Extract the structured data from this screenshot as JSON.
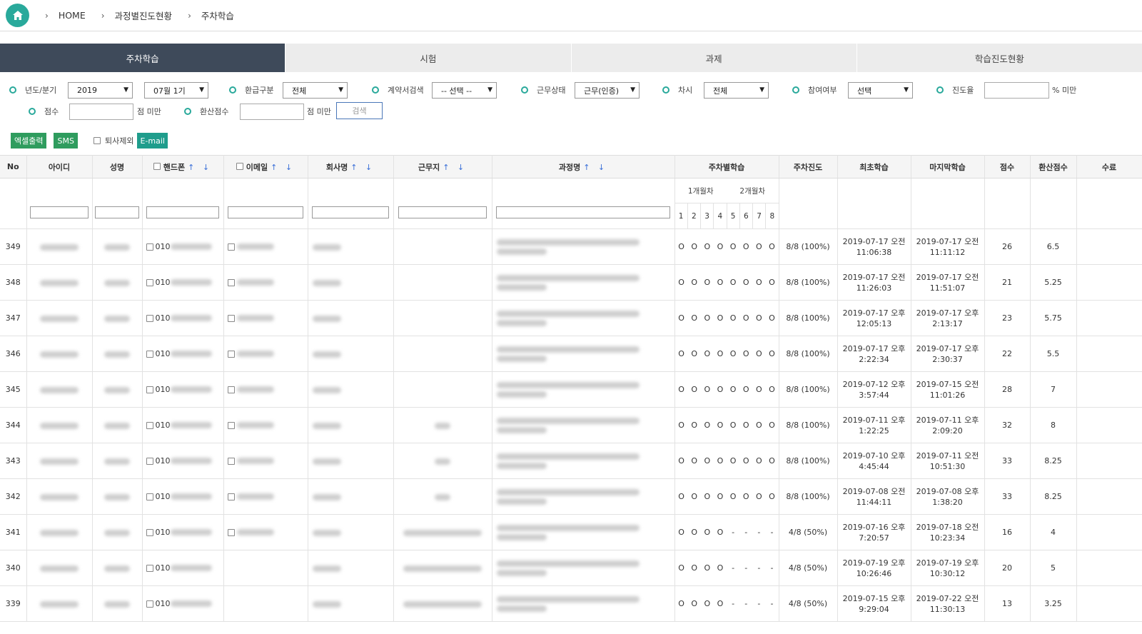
{
  "breadcrumb": {
    "items": [
      "HOME",
      "과정별진도현황",
      "주차학습"
    ]
  },
  "tabs": [
    {
      "label": "주차학습",
      "active": true
    },
    {
      "label": "시험",
      "active": false
    },
    {
      "label": "과제",
      "active": false
    },
    {
      "label": "학습진도현황",
      "active": false
    }
  ],
  "filters": {
    "year_label": "년도/분기",
    "year_value": "2019",
    "quarter_value": "07월 1기",
    "refund_label": "환급구분",
    "refund_value": "전체",
    "contract_label": "계약서검색",
    "contract_value": "-- 선택 --",
    "work_label": "근무상태",
    "work_value": "근무(인증)",
    "round_label": "차시",
    "round_value": "전체",
    "participate_label": "참여여부",
    "participate_value": "선택",
    "progress_label": "진도율",
    "progress_unit": "% 미만",
    "score_label": "점수",
    "score_unit": "점 미만",
    "conv_label": "환산점수",
    "conv_unit": "점 미만",
    "search_button": "검색"
  },
  "actions": {
    "excel": "엑셀출력",
    "sms": "SMS",
    "exclude_label": "퇴사제외",
    "email": "E-mail"
  },
  "table": {
    "headers": {
      "no": "No",
      "id": "아이디",
      "name": "성명",
      "phone": "핸드폰",
      "email": "이메일",
      "company": "회사명",
      "workplace": "근무지",
      "course": "과정명",
      "weekly": "주차별학습",
      "progress": "주차진도",
      "first": "최초학습",
      "last": "마지막학습",
      "score": "점수",
      "conv": "환산점수",
      "complete": "수료",
      "sort_arrows": "↑ ↓"
    },
    "months": [
      "1개월차",
      "2개월차"
    ],
    "weeks": [
      "1",
      "2",
      "3",
      "4",
      "5",
      "6",
      "7",
      "8"
    ],
    "rows": [
      {
        "no": "349",
        "phone_prefix": "010",
        "weeks": [
          "O",
          "O",
          "O",
          "O",
          "O",
          "O",
          "O",
          "O"
        ],
        "progress": "8/8 (100%)",
        "first1": "2019-07-17 오전",
        "first2": "11:06:38",
        "last1": "2019-07-17 오전",
        "last2": "11:11:12",
        "score": "26",
        "conv": "6.5",
        "has_email": true,
        "has_work": false
      },
      {
        "no": "348",
        "phone_prefix": "010",
        "weeks": [
          "O",
          "O",
          "O",
          "O",
          "O",
          "O",
          "O",
          "O"
        ],
        "progress": "8/8 (100%)",
        "first1": "2019-07-17 오전",
        "first2": "11:26:03",
        "last1": "2019-07-17 오전",
        "last2": "11:51:07",
        "score": "21",
        "conv": "5.25",
        "has_email": true,
        "has_work": false
      },
      {
        "no": "347",
        "phone_prefix": "010",
        "weeks": [
          "O",
          "O",
          "O",
          "O",
          "O",
          "O",
          "O",
          "O"
        ],
        "progress": "8/8 (100%)",
        "first1": "2019-07-17 오후",
        "first2": "12:05:13",
        "last1": "2019-07-17 오후",
        "last2": "2:13:17",
        "score": "23",
        "conv": "5.75",
        "has_email": true,
        "has_work": false
      },
      {
        "no": "346",
        "phone_prefix": "010",
        "weeks": [
          "O",
          "O",
          "O",
          "O",
          "O",
          "O",
          "O",
          "O"
        ],
        "progress": "8/8 (100%)",
        "first1": "2019-07-17 오후",
        "first2": "2:22:34",
        "last1": "2019-07-17 오후",
        "last2": "2:30:37",
        "score": "22",
        "conv": "5.5",
        "has_email": true,
        "has_work": false
      },
      {
        "no": "345",
        "phone_prefix": "010",
        "weeks": [
          "O",
          "O",
          "O",
          "O",
          "O",
          "O",
          "O",
          "O"
        ],
        "progress": "8/8 (100%)",
        "first1": "2019-07-12 오후",
        "first2": "3:57:44",
        "last1": "2019-07-15 오전",
        "last2": "11:01:26",
        "score": "28",
        "conv": "7",
        "has_email": true,
        "has_work": false
      },
      {
        "no": "344",
        "phone_prefix": "010",
        "weeks": [
          "O",
          "O",
          "O",
          "O",
          "O",
          "O",
          "O",
          "O"
        ],
        "progress": "8/8 (100%)",
        "first1": "2019-07-11 오후",
        "first2": "1:22:25",
        "last1": "2019-07-11 오후",
        "last2": "2:09:20",
        "score": "32",
        "conv": "8",
        "has_email": true,
        "has_work": true
      },
      {
        "no": "343",
        "phone_prefix": "010",
        "weeks": [
          "O",
          "O",
          "O",
          "O",
          "O",
          "O",
          "O",
          "O"
        ],
        "progress": "8/8 (100%)",
        "first1": "2019-07-10 오후",
        "first2": "4:45:44",
        "last1": "2019-07-11 오전",
        "last2": "10:51:30",
        "score": "33",
        "conv": "8.25",
        "has_email": true,
        "has_work": true
      },
      {
        "no": "342",
        "phone_prefix": "010",
        "weeks": [
          "O",
          "O",
          "O",
          "O",
          "O",
          "O",
          "O",
          "O"
        ],
        "progress": "8/8 (100%)",
        "first1": "2019-07-08 오전",
        "first2": "11:44:11",
        "last1": "2019-07-08 오후",
        "last2": "1:38:20",
        "score": "33",
        "conv": "8.25",
        "has_email": true,
        "has_work": true
      },
      {
        "no": "341",
        "phone_prefix": "010",
        "weeks": [
          "O",
          "O",
          "O",
          "O",
          "-",
          "-",
          "-",
          "-"
        ],
        "progress": "4/8 (50%)",
        "first1": "2019-07-16 오후",
        "first2": "7:20:57",
        "last1": "2019-07-18 오전",
        "last2": "10:23:34",
        "score": "16",
        "conv": "4",
        "has_email": true,
        "has_work": true
      },
      {
        "no": "340",
        "phone_prefix": "010",
        "weeks": [
          "O",
          "O",
          "O",
          "O",
          "-",
          "-",
          "-",
          "-"
        ],
        "progress": "4/8 (50%)",
        "first1": "2019-07-19 오후",
        "first2": "10:26:46",
        "last1": "2019-07-19 오후",
        "last2": "10:30:12",
        "score": "20",
        "conv": "5",
        "has_email": false,
        "has_work": true
      },
      {
        "no": "339",
        "phone_prefix": "010",
        "weeks": [
          "O",
          "O",
          "O",
          "O",
          "-",
          "-",
          "-",
          "-"
        ],
        "progress": "4/8 (50%)",
        "first1": "2019-07-15 오후",
        "first2": "9:29:04",
        "last1": "2019-07-22 오전",
        "last2": "11:30:13",
        "score": "13",
        "conv": "3.25",
        "has_email": false,
        "has_work": true
      }
    ]
  }
}
